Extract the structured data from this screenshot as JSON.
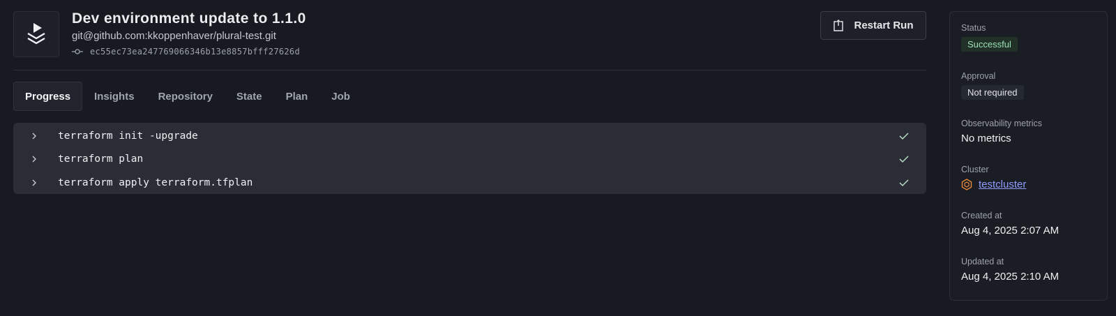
{
  "header": {
    "title": "Dev environment update to 1.1.0",
    "repository": "git@github.com:kkoppenhaver/plural-test.git",
    "commit_sha": "ec55ec73ea247769066346b13e8857bfff27626d",
    "restart_label": "Restart Run"
  },
  "tabs": [
    {
      "label": "Progress",
      "active": true
    },
    {
      "label": "Insights"
    },
    {
      "label": "Repository"
    },
    {
      "label": "State"
    },
    {
      "label": "Plan"
    },
    {
      "label": "Job"
    }
  ],
  "steps": [
    {
      "command": "terraform init -upgrade",
      "status": "completed"
    },
    {
      "command": "terraform plan",
      "status": "completed"
    },
    {
      "command": "terraform apply terraform.tfplan",
      "status": "completed"
    }
  ],
  "sidebar": {
    "status": {
      "label": "Status",
      "value": "Successful"
    },
    "approval": {
      "label": "Approval",
      "value": "Not required"
    },
    "observability": {
      "label": "Observability metrics",
      "value": "No metrics"
    },
    "cluster": {
      "label": "Cluster",
      "value": "testcluster"
    },
    "created": {
      "label": "Created at",
      "value": "Aug 4, 2025 2:07 AM"
    },
    "updated": {
      "label": "Updated at",
      "value": "Aug 4, 2025 2:10 AM"
    }
  },
  "colors": {
    "background": "#171a21",
    "success_text": "#9be0b4",
    "link": "#8f9dff",
    "cluster_icon": "#e88a3c"
  }
}
